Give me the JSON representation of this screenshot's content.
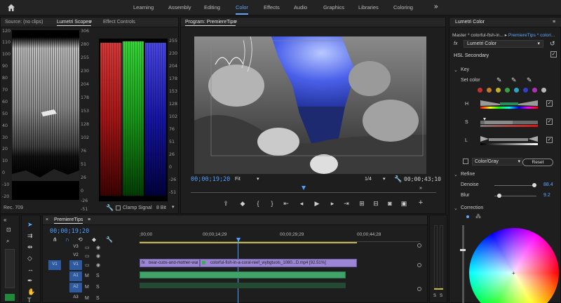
{
  "workspaces": [
    "Learning",
    "Assembly",
    "Editing",
    "Color",
    "Effects",
    "Audio",
    "Graphics",
    "Libraries",
    "Coloring"
  ],
  "active_workspace": "Color",
  "source_panel": {
    "tabs": [
      "Source: (no clips)",
      "Lumetri Scopes",
      "Effect Controls"
    ],
    "active_tab": "Lumetri Scopes",
    "waveform_scale_left": [
      "120",
      "110",
      "100",
      "90",
      "80",
      "70",
      "60",
      "50",
      "40",
      "30",
      "20",
      "10",
      "0",
      "-10",
      "-20"
    ],
    "waveform_scale_right": [
      "306",
      "280",
      "255",
      "230",
      "204",
      "178",
      "153",
      "128",
      "102",
      "76",
      "51",
      "26",
      "0",
      "-26",
      "-51"
    ],
    "parade_scale_right": [
      "255",
      "230",
      "204",
      "178",
      "153",
      "128",
      "102",
      "76",
      "51",
      "26",
      "0",
      "-26",
      "-51"
    ],
    "footer_left": "Rec. 709",
    "clamp_signal": "Clamp Signal",
    "bit_depth": "8 Bit"
  },
  "program": {
    "title": "Program: PremiereTips",
    "timecode": "00;00;19;20",
    "fit": "Fit",
    "resolution": "1/4",
    "duration": "00;00;43;10"
  },
  "lumetri": {
    "title": "Lumetri Color",
    "master_path": "Master * colorful-fish-in...",
    "sequence_path": "PremiereTips * colori...",
    "effect_name": "Lumetri Color",
    "section": "HSL Secondary",
    "key_label": "Key",
    "set_color_label": "Set color",
    "swatches": [
      "#c43030",
      "#c47a28",
      "#c4b028",
      "#3ca040",
      "#2aa6c0",
      "#3040c8",
      "#b030b8",
      "#b8b8b8"
    ],
    "h_label": "H",
    "s_label": "S",
    "l_label": "L",
    "color_gray": "Color/Gray",
    "reset": "Reset",
    "refine": "Refine",
    "denoise_label": "Denoise",
    "denoise_value": "88.4",
    "blur_label": "Blur",
    "blur_value": "9.2",
    "correction": "Correction"
  },
  "timeline": {
    "title": "PremiereTips",
    "timecode": "00;00;19;20",
    "ruler": [
      ";00;00",
      "00;00;14;29",
      "00;00;29;29",
      "00;00;44;28"
    ],
    "tracks_video": [
      "V3",
      "V2",
      "V1"
    ],
    "tracks_audio": [
      "A1",
      "A2",
      "A3"
    ],
    "source_patch_v": "V1",
    "source_patch_a": "A1",
    "clip1_name": "bear-cubs-and-mother-wal",
    "clip2_name": "colorful-fish-in-a-coral-reef_wybgtuols_1080...D.mp4 [92.51%]"
  },
  "meters": {
    "db_scale": [
      "S",
      "S"
    ]
  }
}
